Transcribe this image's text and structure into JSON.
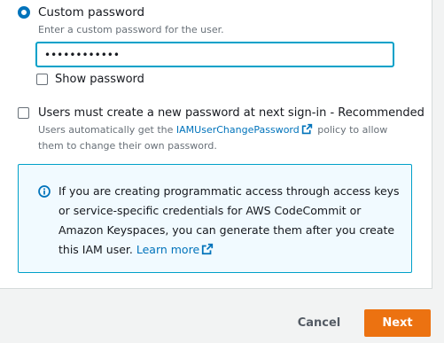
{
  "password_options": {
    "custom_password_label": "Custom password",
    "custom_password_selected": true,
    "custom_password_description": "Enter a custom password for the user.",
    "password_value": "••••••••••••",
    "show_password_label": "Show password",
    "show_password_checked": false
  },
  "reset_requirement": {
    "label": "Users must create a new password at next sign-in - Recommended",
    "checked": false,
    "description_before_link": "Users automatically get the ",
    "policy_link": "IAMUserChangePassword",
    "description_after_link": " policy to allow them to change their own password."
  },
  "info_alert": {
    "text": "If you are creating programmatic access through access keys or service-specific credentials for AWS CodeCommit or Amazon Keyspaces, you can generate them after you create this IAM user. ",
    "learn_more_label": "Learn more"
  },
  "footer": {
    "cancel_label": "Cancel",
    "next_label": "Next"
  },
  "colors": {
    "accent": "#0073bb",
    "primary_button": "#ec7211",
    "focus_border": "#00a1c9",
    "info_background": "#f1faff"
  },
  "icons": [
    "radio-selected-icon",
    "external-link-icon",
    "info-icon"
  ]
}
